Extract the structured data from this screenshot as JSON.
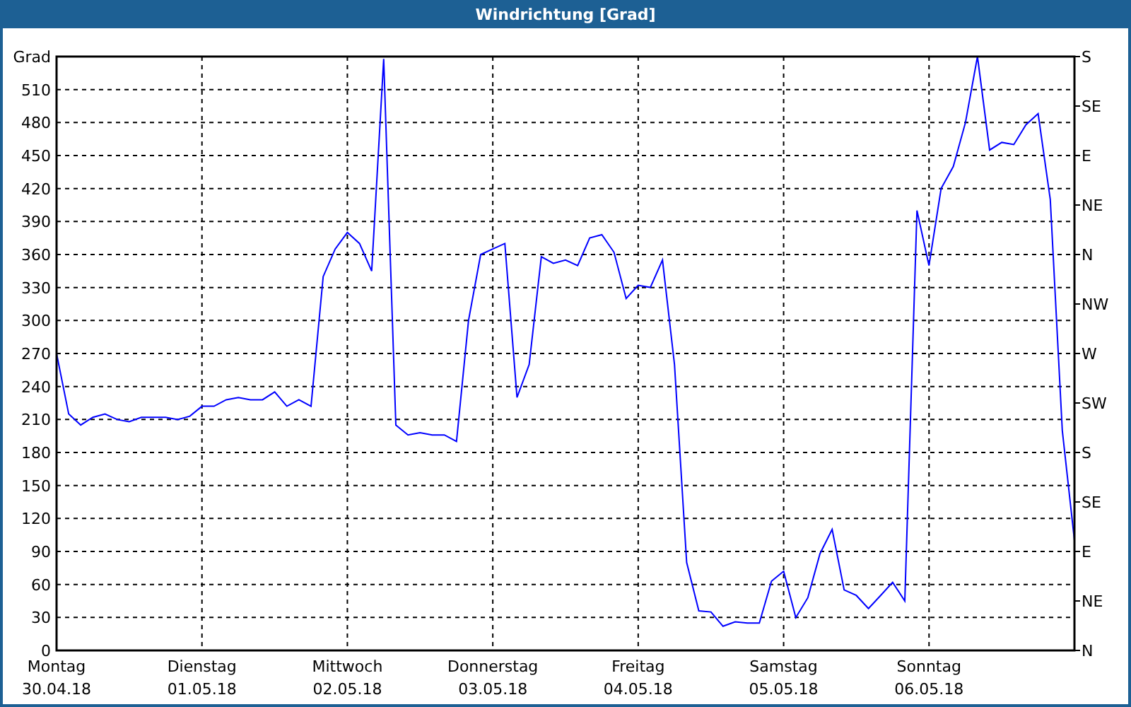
{
  "window": {
    "title": "Windrichtung [Grad]"
  },
  "chart": {
    "chart_data": {
      "type": "line",
      "ylabel": "Grad",
      "grid": true,
      "categories": [
        "Montag\n30.04.18",
        null,
        null,
        null,
        null,
        null,
        null,
        null,
        null,
        null,
        null,
        null,
        "Dienstag\n01.05.18",
        null,
        null,
        null,
        null,
        null,
        null,
        null,
        null,
        null,
        null,
        null,
        "Mittwoch\n02.05.18",
        null,
        null,
        null,
        null,
        null,
        null,
        null,
        null,
        null,
        null,
        null,
        "Donnerstag\n03.05.18",
        null,
        null,
        null,
        null,
        null,
        null,
        null,
        null,
        null,
        null,
        null,
        "Freitag\n04.05.18",
        null,
        null,
        null,
        null,
        null,
        null,
        null,
        null,
        null,
        null,
        null,
        "Samstag\n05.05.18",
        null,
        null,
        null,
        null,
        null,
        null,
        null,
        null,
        null,
        null,
        null,
        "Sonntag\n06.05.18",
        null,
        null,
        null,
        null,
        null,
        null,
        null,
        null,
        null,
        null,
        null,
        null
      ],
      "series": [
        {
          "color": "#0000ff",
          "values": [
            270,
            215,
            205,
            212,
            215,
            210,
            208,
            212,
            212,
            212,
            210,
            213,
            222,
            222,
            228,
            230,
            228,
            228,
            235,
            222,
            228,
            222,
            340,
            365,
            380,
            370,
            345,
            538,
            205,
            196,
            198,
            196,
            196,
            190,
            300,
            360,
            365,
            370,
            230,
            260,
            358,
            352,
            355,
            350,
            375,
            378,
            362,
            320,
            332,
            330,
            355,
            260,
            80,
            36,
            35,
            22,
            26,
            25,
            25,
            63,
            72,
            30,
            48,
            88,
            110,
            55,
            50,
            38,
            50,
            62,
            45,
            400,
            350,
            420,
            440,
            480,
            540,
            455,
            462,
            460,
            478,
            488,
            410,
            200,
            100
          ]
        }
      ],
      "ylim": [
        0,
        540
      ],
      "yticks": [
        0,
        30,
        60,
        90,
        120,
        150,
        180,
        210,
        240,
        270,
        300,
        330,
        360,
        390,
        420,
        450,
        480,
        510
      ]
    },
    "compass_labels": [
      "S",
      "SE",
      "E",
      "NE",
      "N",
      "NW",
      "W",
      "SW",
      "S",
      "SE",
      "E",
      "NE",
      "N"
    ]
  }
}
